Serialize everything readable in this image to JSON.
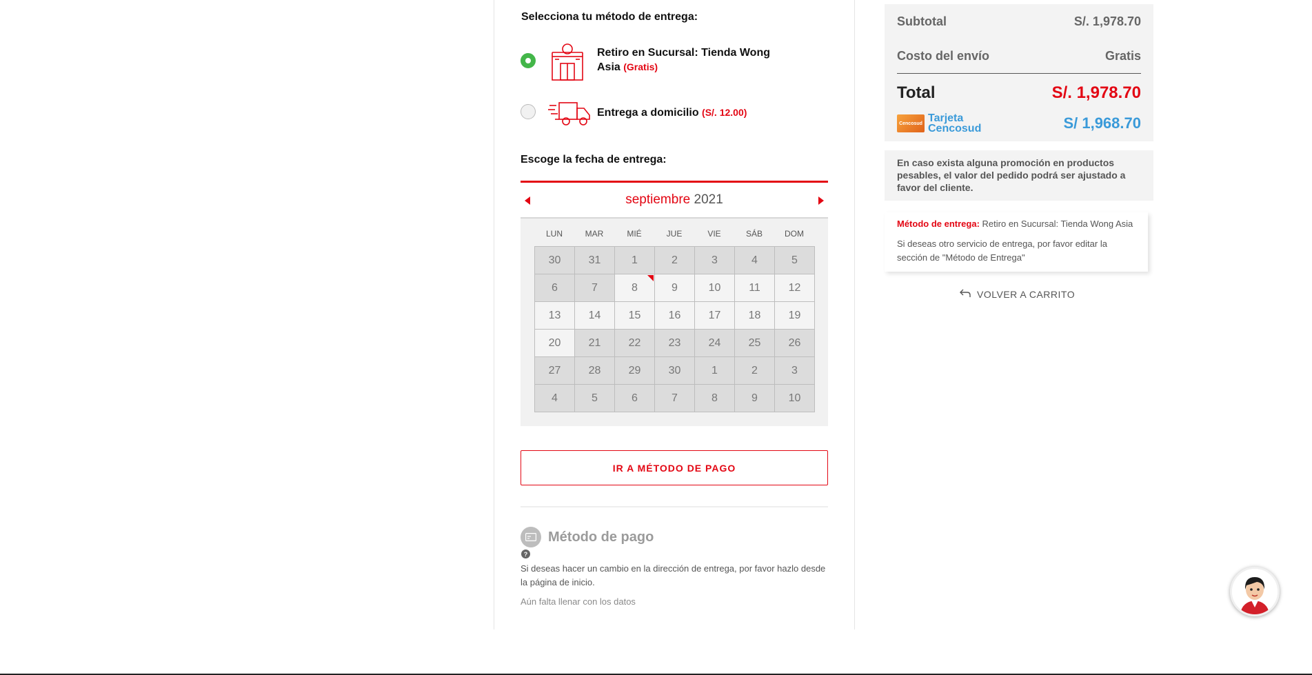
{
  "delivery": {
    "heading": "Selecciona tu método de entrega:",
    "options": [
      {
        "label": "Retiro en Sucursal: Tienda Wong Asia",
        "price": "(Gratis)",
        "selected": true,
        "icon": "store-icon"
      },
      {
        "label": "Entrega a domicilio",
        "price": "(S/. 12.00)",
        "selected": false,
        "icon": "truck-icon"
      }
    ]
  },
  "date_picker": {
    "heading": "Escoge la fecha de entrega:",
    "month": "septiembre",
    "year": "2021",
    "weekdays": [
      "LUN",
      "MAR",
      "MIÉ",
      "JUE",
      "VIE",
      "SÁB",
      "DOM"
    ],
    "days": [
      "30",
      "31",
      "1",
      "2",
      "3",
      "4",
      "5",
      "6",
      "7",
      "8",
      "9",
      "10",
      "11",
      "12",
      "13",
      "14",
      "15",
      "16",
      "17",
      "18",
      "19",
      "20",
      "21",
      "22",
      "23",
      "24",
      "25",
      "26",
      "27",
      "28",
      "29",
      "30",
      "1",
      "2",
      "3",
      "4",
      "5",
      "6",
      "7",
      "8",
      "9",
      "10"
    ],
    "available_day_indexes": [
      9,
      10,
      11,
      12,
      13,
      14,
      15,
      16,
      17,
      18,
      19,
      20,
      21
    ],
    "marked_day_index": 9
  },
  "payment_button": {
    "label": "IR A MÉTODO DE PAGO"
  },
  "payment_section": {
    "title": "Método de pago",
    "help": "?",
    "note": "Si deseas hacer un cambio en la dirección de entrega, por favor hazlo desde la página de inicio.",
    "pending": "Aún falta llenar con los datos"
  },
  "summary": {
    "subtotal_label": "Subtotal",
    "subtotal_value": "S/. 1,978.70",
    "shipping_label": "Costo del envío",
    "shipping_value": "Gratis",
    "total_label": "Total",
    "total_value": "S/. 1,978.70",
    "card_label": "Tarjeta Cencosud",
    "card_logo_text": "Cencosud",
    "card_value": "S/ 1,968.70"
  },
  "promo_note": "En caso exista alguna promoción en productos pesables, el valor del pedido podrá ser ajustado a favor del cliente.",
  "method_info": {
    "label": "Método de entrega:",
    "value": "Retiro en Sucursal: Tienda Wong Asia",
    "hint": "Si deseas otro servicio de entrega, por favor editar la sección de \"Método de Entrega\""
  },
  "back_link": {
    "label": "VOLVER A CARRITO"
  },
  "colors": {
    "accent": "#e30613",
    "selected": "#43b649",
    "card_blue": "#3a9ad9"
  }
}
